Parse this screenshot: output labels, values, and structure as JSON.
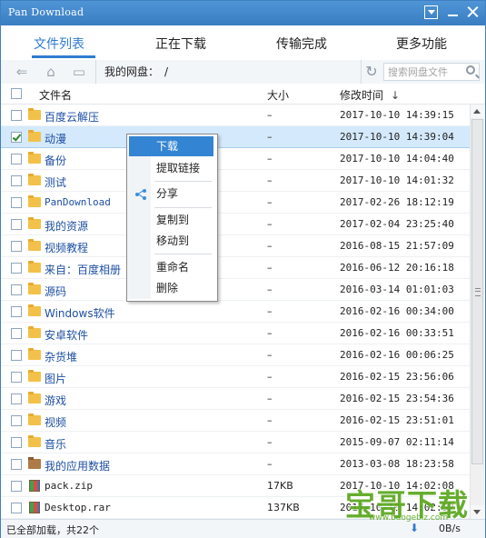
{
  "window": {
    "title": "Pan Download"
  },
  "tabs": [
    {
      "label": "文件列表",
      "active": true
    },
    {
      "label": "正在下载",
      "active": false
    },
    {
      "label": "传输完成",
      "active": false
    },
    {
      "label": "更多功能",
      "active": false
    }
  ],
  "toolbar": {
    "path_label": "我的网盘：",
    "path_value": "/",
    "search_placeholder": "搜索网盘文件"
  },
  "columns": {
    "name": "文件名",
    "size": "大小",
    "modified": "修改时间",
    "sort_indicator": "↓"
  },
  "files": [
    {
      "name": "百度云解压",
      "size": "–",
      "modified": "2017-10-10 14:39:15",
      "type": "folder",
      "checked": false,
      "selected": false
    },
    {
      "name": "动漫",
      "size": "–",
      "modified": "2017-10-10 14:39:04",
      "type": "folder",
      "checked": true,
      "selected": true
    },
    {
      "name": "备份",
      "size": "–",
      "modified": "2017-10-10 14:04:40",
      "type": "folder",
      "checked": false,
      "selected": false
    },
    {
      "name": "测试",
      "size": "–",
      "modified": "2017-10-10 14:01:32",
      "type": "folder",
      "checked": false,
      "selected": false
    },
    {
      "name": "PanDownload",
      "size": "–",
      "modified": "2017-02-26 18:12:19",
      "type": "folder",
      "checked": false,
      "selected": false,
      "mono": true
    },
    {
      "name": "我的资源",
      "size": "–",
      "modified": "2017-02-04 23:25:40",
      "type": "folder",
      "checked": false,
      "selected": false
    },
    {
      "name": "视频教程",
      "size": "–",
      "modified": "2016-08-15 21:57:09",
      "type": "folder",
      "checked": false,
      "selected": false
    },
    {
      "name": "来自：百度相册",
      "size": "–",
      "modified": "2016-06-12 20:16:18",
      "type": "folder",
      "checked": false,
      "selected": false
    },
    {
      "name": "源码",
      "size": "–",
      "modified": "2016-03-14 01:01:03",
      "type": "folder",
      "checked": false,
      "selected": false
    },
    {
      "name": "Windows软件",
      "size": "–",
      "modified": "2016-02-16 00:34:00",
      "type": "folder",
      "checked": false,
      "selected": false
    },
    {
      "name": "安卓软件",
      "size": "–",
      "modified": "2016-02-16 00:33:51",
      "type": "folder",
      "checked": false,
      "selected": false
    },
    {
      "name": "杂货堆",
      "size": "–",
      "modified": "2016-02-16 00:06:25",
      "type": "folder",
      "checked": false,
      "selected": false
    },
    {
      "name": "图片",
      "size": "–",
      "modified": "2016-02-15 23:56:06",
      "type": "folder",
      "checked": false,
      "selected": false
    },
    {
      "name": "游戏",
      "size": "–",
      "modified": "2016-02-15 23:54:36",
      "type": "folder",
      "checked": false,
      "selected": false
    },
    {
      "name": "视频",
      "size": "–",
      "modified": "2016-02-15 23:51:01",
      "type": "folder",
      "checked": false,
      "selected": false
    },
    {
      "name": "音乐",
      "size": "–",
      "modified": "2015-09-07 02:11:14",
      "type": "folder",
      "checked": false,
      "selected": false
    },
    {
      "name": "我的应用数据",
      "size": "–",
      "modified": "2013-03-08 18:23:58",
      "type": "app-folder",
      "checked": false,
      "selected": false
    },
    {
      "name": "pack.zip",
      "size": "17KB",
      "modified": "2017-10-10 14:02:08",
      "type": "archive",
      "checked": false,
      "selected": false,
      "mono": true
    },
    {
      "name": "Desktop.rar",
      "size": "137KB",
      "modified": "2017-10-10 14:02:32",
      "type": "archive",
      "checked": false,
      "selected": false,
      "mono": true
    }
  ],
  "context_menu": {
    "items": [
      "下载",
      "提取链接",
      "分享",
      "复制到",
      "移动到",
      "重命名",
      "删除"
    ],
    "highlighted": "下载"
  },
  "status": {
    "text": "已全部加载，共22个",
    "right": "0B/s"
  },
  "watermark": {
    "text": "宝哥下载",
    "sub": "www.baogebiz.com"
  },
  "colors": {
    "accent": "#2f7bd0",
    "titlebar": "#3a7dc2",
    "selection": "#d4e9fb",
    "menu_highlight": "#3384d2",
    "link": "#1e4fa3"
  }
}
